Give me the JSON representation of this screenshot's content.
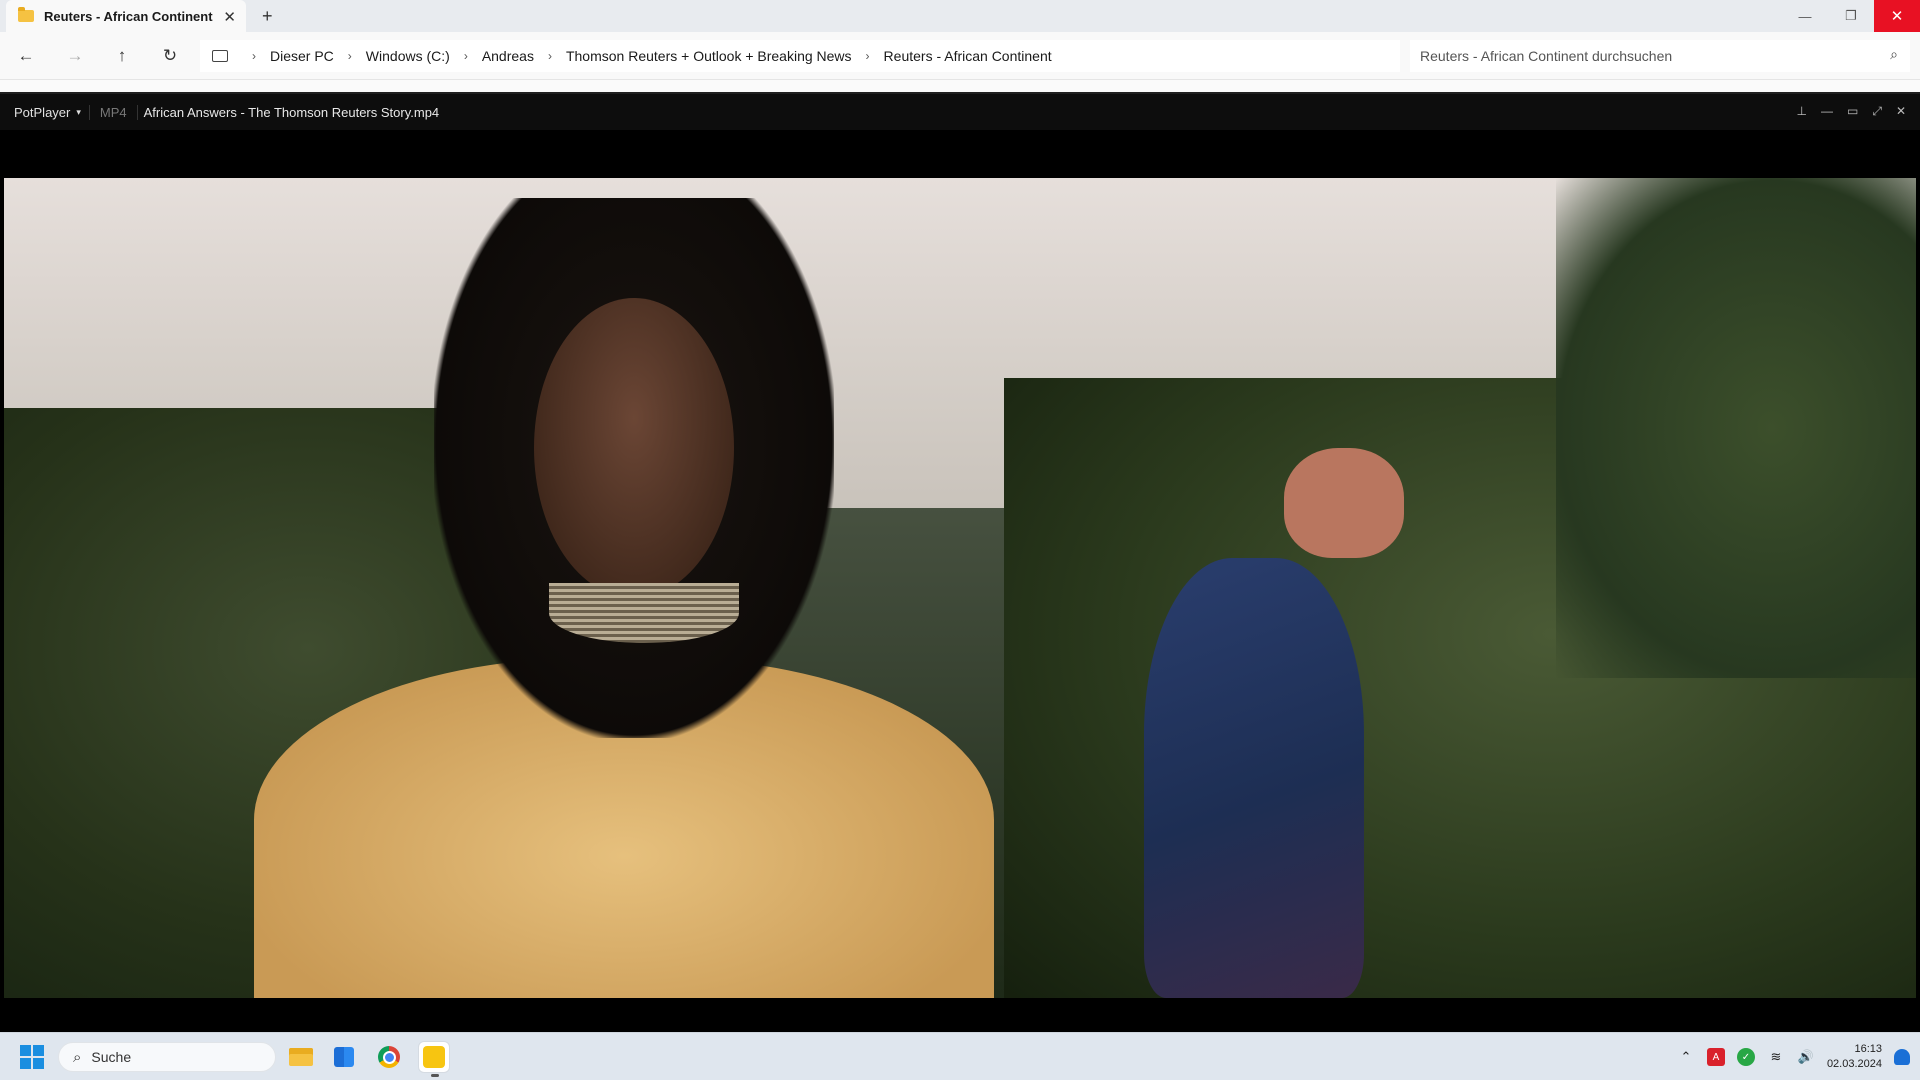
{
  "explorer": {
    "tab_title": "Reuters - African Continent",
    "tab_close": "✕",
    "new_tab": "+",
    "breadcrumbs": [
      "Dieser PC",
      "Windows (C:)",
      "Andreas",
      "Thomson Reuters + Outlook + Breaking News",
      "Reuters - African Continent"
    ],
    "search_placeholder": "Reuters - African Continent durchsuchen",
    "window_controls": [
      "minimize-icon",
      "restore-icon",
      "close-icon"
    ]
  },
  "player": {
    "brand": "PotPlayer",
    "format": "MP4",
    "file_name": "African Answers - The Thomson Reuters Story.mp4",
    "controls": [
      "pin-icon",
      "minimize-icon",
      "maximize-icon",
      "fullscreen-icon",
      "close-icon"
    ]
  },
  "taskbar": {
    "search_label": "Suche",
    "apps": [
      "file-explorer",
      "microsoft-store",
      "chrome",
      "potplayer"
    ],
    "time": "16:13",
    "date": "02.03.2024"
  },
  "colors": {
    "close_red": "#e81123",
    "taskbar_bg": "#dfe6ee",
    "player_bg": "#000000",
    "windows_blue": "#1a8ee0"
  }
}
